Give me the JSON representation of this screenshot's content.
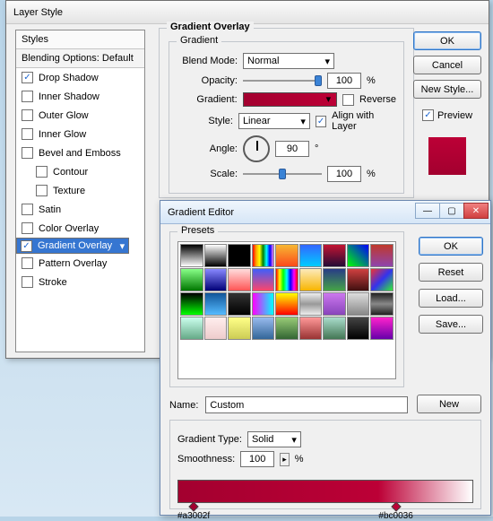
{
  "layer_style": {
    "window_title": "Layer Style",
    "styles_header": "Styles",
    "blending_default": "Blending Options: Default",
    "items": [
      {
        "label": "Drop Shadow",
        "checked": true,
        "selected": false
      },
      {
        "label": "Inner Shadow",
        "checked": false,
        "selected": false
      },
      {
        "label": "Outer Glow",
        "checked": false,
        "selected": false
      },
      {
        "label": "Inner Glow",
        "checked": false,
        "selected": false
      },
      {
        "label": "Bevel and Emboss",
        "checked": false,
        "selected": false
      },
      {
        "label": "Contour",
        "checked": false,
        "selected": false,
        "indent": true
      },
      {
        "label": "Texture",
        "checked": false,
        "selected": false,
        "indent": true
      },
      {
        "label": "Satin",
        "checked": false,
        "selected": false
      },
      {
        "label": "Color Overlay",
        "checked": false,
        "selected": false
      },
      {
        "label": "Gradient Overlay",
        "checked": true,
        "selected": true
      },
      {
        "label": "Pattern Overlay",
        "checked": false,
        "selected": false
      },
      {
        "label": "Stroke",
        "checked": false,
        "selected": false
      }
    ],
    "group_title": "Gradient Overlay",
    "inner_title": "Gradient",
    "labels": {
      "blend_mode": "Blend Mode:",
      "opacity": "Opacity:",
      "gradient": "Gradient:",
      "style": "Style:",
      "angle": "Angle:",
      "scale": "Scale:",
      "reverse": "Reverse",
      "align": "Align with Layer",
      "pct": "%",
      "deg": "°"
    },
    "values": {
      "blend_mode": "Normal",
      "opacity": "100",
      "style": "Linear",
      "angle": "90",
      "scale": "100",
      "reverse": false,
      "align": true
    },
    "buttons": {
      "ok": "OK",
      "cancel": "Cancel",
      "new_style": "New Style..."
    },
    "preview_label": "Preview",
    "preview_checked": true
  },
  "gradient_editor": {
    "window_title": "Gradient Editor",
    "presets_title": "Presets",
    "buttons": {
      "ok": "OK",
      "reset": "Reset",
      "load": "Load...",
      "save": "Save...",
      "new": "New"
    },
    "name_label": "Name:",
    "name_value": "Custom",
    "grad_type_label": "Gradient Type:",
    "grad_type_value": "Solid",
    "smooth_label": "Smoothness:",
    "smooth_value": "100",
    "pct": "%",
    "stops": [
      {
        "pos": 0,
        "hex": "#a3002f"
      },
      {
        "pos": 68,
        "hex": "#bc0036"
      }
    ],
    "preset_swatches": [
      "linear-gradient(#000,#fff)",
      "linear-gradient(#fff,#000)",
      "linear-gradient(#000,#000)",
      "linear-gradient(to right,red,orange,yellow,green,cyan,blue,violet)",
      "linear-gradient(#f7b733,#fc4a1a)",
      "linear-gradient(#3366ff,#00ccff)",
      "linear-gradient(#c31432,#240b36)",
      "linear-gradient(45deg,#0f0,#00f)",
      "linear-gradient(#c0392b,#8e44ad)",
      "linear-gradient(#8f8,#070)",
      "linear-gradient(#88f,#007)",
      "linear-gradient(#fdd,#f55)",
      "linear-gradient(#3f5efb,#fc466b)",
      "linear-gradient(to right,red,yellow,lime,cyan,blue,magenta,red)",
      "linear-gradient(#fceabb,#f8b500)",
      "linear-gradient(#283c86,#45a247)",
      "linear-gradient(#d04040,#401010)",
      "linear-gradient(135deg,#e33,#33e 50%,#3e3)",
      "linear-gradient(#000,#0f0)",
      "linear-gradient(#159,#5bf)",
      "linear-gradient(#333,#000)",
      "linear-gradient(to right,#f0f,#0ff)",
      "linear-gradient(#ff0,#f00)",
      "linear-gradient(#eee,#999,#eee)",
      "linear-gradient(#c7e,#84b)",
      "linear-gradient(#ddd,#888)",
      "linear-gradient(#222,#888,#222)",
      "linear-gradient(#cfe,#6a8)",
      "linear-gradient(#fee,#ecc)",
      "linear-gradient(#ff8,#cc5)",
      "linear-gradient(#9be,#369)",
      "linear-gradient(#9c7,#363)",
      "linear-gradient(#f99,#933)",
      "linear-gradient(#adc,#475)",
      "linear-gradient(#444,#000)",
      "linear-gradient(#f2c,#60a)"
    ]
  }
}
